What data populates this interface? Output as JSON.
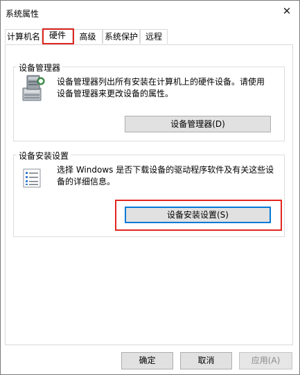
{
  "window": {
    "title": "系统属性",
    "close_glyph": "✕"
  },
  "tabs": [
    {
      "label": "计算机名"
    },
    {
      "label": "硬件"
    },
    {
      "label": "高级"
    },
    {
      "label": "系统保护"
    },
    {
      "label": "远程"
    }
  ],
  "device_manager": {
    "legend": "设备管理器",
    "description": "设备管理器列出所有安装在计算机上的硬件设备。请使用设备管理器来更改设备的属性。",
    "button_label": "设备管理器(D)",
    "icon": "device-manager-icon"
  },
  "device_install": {
    "legend": "设备安装设置",
    "description": "选择 Windows 是否下载设备的驱动程序软件及有关这些设备的详细信息。",
    "button_label": "设备安装设置(S)",
    "icon": "checklist-icon"
  },
  "footer": {
    "ok_label": "确定",
    "cancel_label": "取消",
    "apply_label": "应用(A)"
  },
  "colors": {
    "highlight": "#e0261f",
    "focus": "#0078d7"
  }
}
